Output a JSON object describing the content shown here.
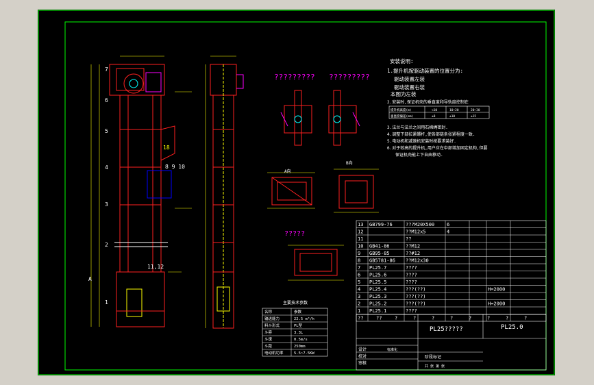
{
  "install_notes": {
    "title": "安装说明:",
    "item1": "1.提升机按驱动装置的位置分为:",
    "item1a": "驱动装置左装",
    "item1b": "驱动装置右装",
    "item1c": "本图为左装",
    "item2": "2.安装时,保证机壳的垂直度和导轨度控制在",
    "item3": "3.法兰与法兰之间用石棉绳密封.",
    "item4": "4.调整下部拉紧螺杆,使各部链条张紧程度一致.",
    "item5": "5.电动机和减速机安装时按要求装好.",
    "item6": "6.对于较高的提升机,用户应在中部增加固定机构,但要",
    "item6b": "保证机壳能上下自由移动."
  },
  "tolerance_table": {
    "rows": [
      [
        "提升机高度(m)",
        "<10",
        "10~20",
        "20~30"
      ],
      [
        "垂直度偏差(mm)",
        "±8",
        "±10",
        "±15"
      ]
    ]
  },
  "views": {
    "view_a": "A向",
    "view_b": "B向",
    "title_q1": "?????????",
    "title_q2": "?????????",
    "title_q3": "?????",
    "left_label_18": "18",
    "label_a": "A",
    "label_8910": "8  9  10",
    "label_1112": "11,12"
  },
  "balloons": [
    "7",
    "6",
    "5",
    "4",
    "3",
    "2",
    "1"
  ],
  "main_params": {
    "title": "主要技术参数",
    "header": [
      "名称",
      "参数"
    ],
    "rows": [
      [
        "输送能力",
        "22.5 m³/h"
      ],
      [
        "料斗形式",
        "PL型"
      ],
      [
        "斗容",
        "3.3L"
      ],
      [
        "斗速",
        "0.5m/s"
      ],
      [
        "斗距",
        "250mm"
      ],
      [
        "电动机功率",
        "5.5~7.5KW"
      ]
    ]
  },
  "bom": {
    "rows": [
      [
        "13",
        "GB799-76",
        "???M20X500",
        "6",
        "",
        ""
      ],
      [
        "12",
        "",
        "??M12x5",
        "4",
        "",
        ""
      ],
      [
        "11",
        "",
        "??",
        "",
        "",
        ""
      ],
      [
        "10",
        "GB41-86",
        "??M12",
        "",
        "",
        ""
      ],
      [
        "9",
        "GB95-85",
        "??#12",
        "",
        "",
        ""
      ],
      [
        "8",
        "GB5781-86",
        "??M12x30",
        "",
        "",
        ""
      ],
      [
        "7",
        "PL25.7",
        "????",
        "",
        "",
        ""
      ],
      [
        "6",
        "PL25.6",
        "????",
        "",
        "",
        ""
      ],
      [
        "5",
        "PL25.5",
        "????",
        "",
        "",
        ""
      ],
      [
        "4",
        "PL25.4",
        "???(??)",
        "",
        "",
        "H=2000"
      ],
      [
        "3",
        "PL25.3",
        "???(??)",
        "",
        "",
        ""
      ],
      [
        "2",
        "PL25.2",
        "???(??)",
        "",
        "",
        "H=2000"
      ],
      [
        "1",
        "PL25.1",
        "????",
        "",
        "",
        ""
      ]
    ],
    "header": [
      "??",
      "??",
      "?",
      "?",
      "?",
      "?",
      "?",
      "?",
      "?",
      "?"
    ]
  },
  "title_block": {
    "name": "PL25?????",
    "drawing_no": "PL25.0",
    "designer": "设计",
    "checker": "校对",
    "approver": "审核",
    "stage": "阶段标记",
    "sheet": "共     张  第     张",
    "std": "标准化"
  },
  "colors": {
    "background": "#000000",
    "frame": "#00ff00",
    "drawing": "#ff2020",
    "text": "#ffffff",
    "dimension": "#ffff00"
  }
}
